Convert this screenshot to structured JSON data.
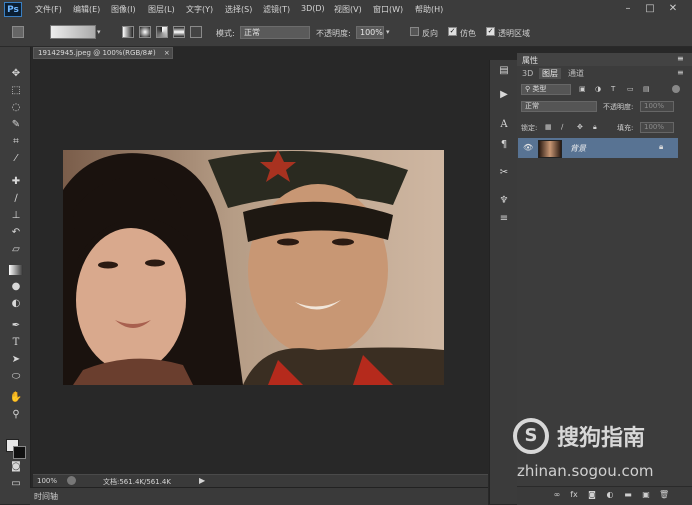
{
  "app": {
    "logo": "Ps"
  },
  "menu": [
    "文件(F)",
    "编辑(E)",
    "图像(I)",
    "图层(L)",
    "文字(Y)",
    "选择(S)",
    "滤镜(T)",
    "3D(D)",
    "视图(V)",
    "窗口(W)",
    "帮助(H)"
  ],
  "window_controls": [
    "–",
    "□",
    "✕"
  ],
  "options": {
    "mode_label": "模式:",
    "mode_value": "正常",
    "opacity_label": "不透明度:",
    "opacity_value": "100%",
    "reverse_label": "反向",
    "dither_label": "仿色",
    "transparency_label": "透明区域"
  },
  "document": {
    "tab_title": "19142945.jpeg @ 100%(RGB/8#)",
    "tab_close": "×",
    "zoom": "100%",
    "doc_info": "文档:561.4K/561.4K"
  },
  "timeline_label": "时间轴",
  "panels": {
    "properties_title": "属性",
    "tabs": [
      "3D",
      "图层",
      "通道"
    ],
    "active_tab": "图层",
    "filter_label": "类型",
    "blend_mode": "正常",
    "opacity_label": "不透明度:",
    "opacity_value": "100%",
    "lock_label": "锁定:",
    "fill_label": "填充:",
    "fill_value": "100%",
    "layer_name": "背景"
  },
  "watermark": {
    "brand": "搜狗指南",
    "url": "zhinan.sogou.com",
    "logo_letter": "S"
  },
  "icons": {
    "tools": [
      "move-icon",
      "marquee-icon",
      "lasso-icon",
      "quick-select-icon",
      "crop-icon",
      "eyedropper-icon",
      "healing-icon",
      "brush-icon",
      "stamp-icon",
      "history-brush-icon",
      "eraser-icon",
      "gradient-icon",
      "blur-icon",
      "dodge-icon",
      "pen-icon",
      "type-icon",
      "path-select-icon",
      "shape-icon",
      "hand-icon",
      "zoom-icon",
      "color-swatch-icon",
      "quick-mask-icon",
      "screen-mode-icon"
    ],
    "dock": [
      "history-panel-icon",
      "actions-panel-icon",
      "info-panel-icon",
      "character-panel-icon",
      "paragraph-panel-icon",
      "tools-preset-icon",
      "brush-preset-icon",
      "adjustments-icon"
    ]
  },
  "colors": {
    "accent_layer": "#587393",
    "background": "#282828",
    "panel": "#3c3c3c"
  }
}
